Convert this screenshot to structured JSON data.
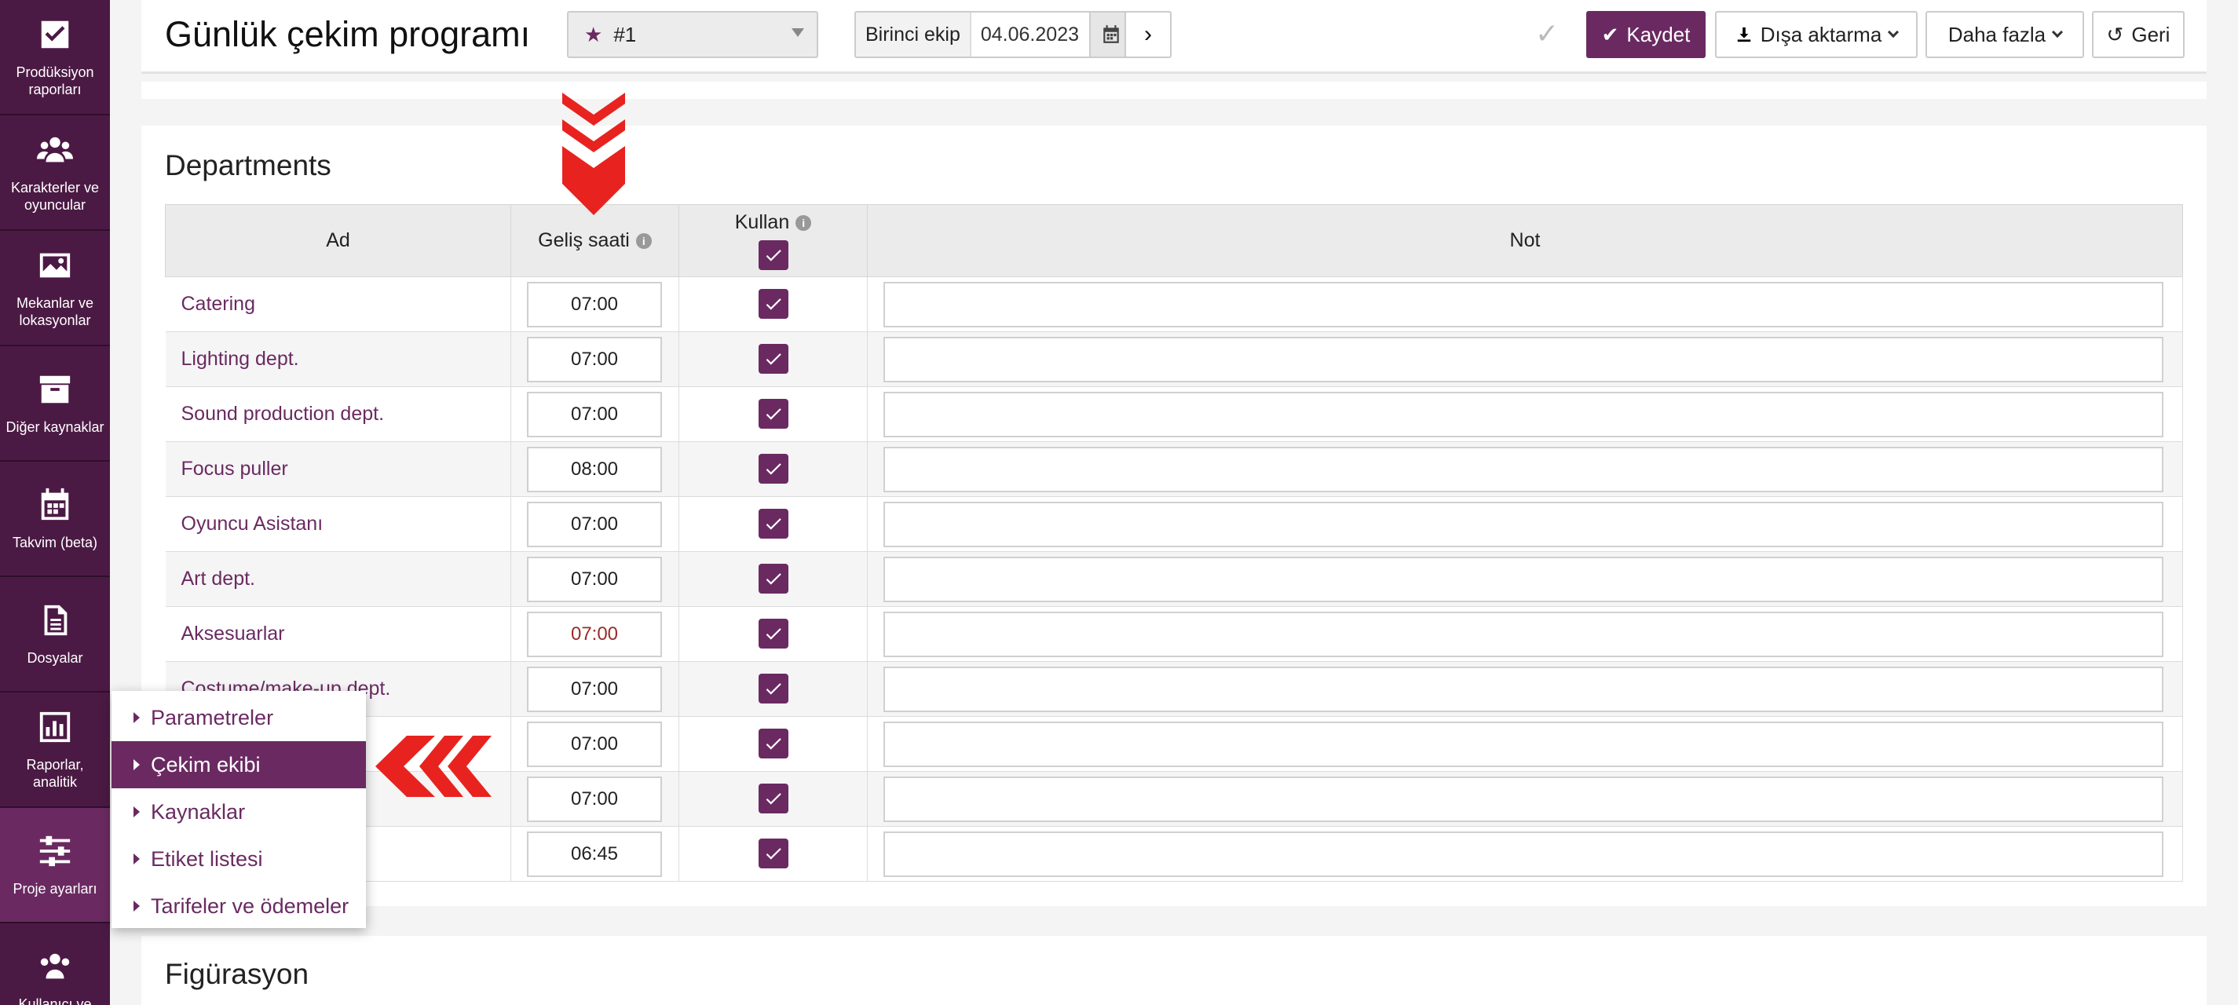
{
  "sidebar": {
    "items": [
      {
        "label": "Prodüksiyon raporları",
        "icon": "check-square-icon"
      },
      {
        "label": "Karakterler ve oyuncular",
        "icon": "users-icon"
      },
      {
        "label": "Mekanlar ve lokasyonlar",
        "icon": "image-icon"
      },
      {
        "label": "Diğer kaynaklar",
        "icon": "archive-icon"
      },
      {
        "label": "Takvim (beta)",
        "icon": "calendar-icon"
      },
      {
        "label": "Dosyalar",
        "icon": "file-icon"
      },
      {
        "label": "Raporlar, analitik",
        "icon": "bar-chart-icon"
      },
      {
        "label": "Proje ayarları",
        "icon": "sliders-icon"
      },
      {
        "label": "Kullanıcı ve",
        "icon": "users-icon"
      }
    ]
  },
  "header": {
    "title": "Günlük çekim programı",
    "version": "#1",
    "unit_label": "Birinci ekip",
    "date": "04.06.2023",
    "next_symbol": "›",
    "save_label": "Kaydet",
    "export_label": "Dışa aktarma",
    "more_label": "Daha fazla",
    "back_label": "Geri"
  },
  "departments": {
    "title": "Departments",
    "columns": {
      "name": "Ad",
      "arrival": "Geliş saati",
      "use": "Kullan",
      "note": "Not"
    },
    "rows": [
      {
        "name": "Catering",
        "time": "07:00",
        "checked": true
      },
      {
        "name": "Lighting dept.",
        "time": "07:00",
        "checked": true
      },
      {
        "name": "Sound production dept.",
        "time": "07:00",
        "checked": true
      },
      {
        "name": "Focus puller",
        "time": "08:00",
        "checked": true
      },
      {
        "name": "Oyuncu Asistanı",
        "time": "07:00",
        "checked": true
      },
      {
        "name": "Art dept.",
        "time": "07:00",
        "checked": true
      },
      {
        "name": "Aksesuarlar",
        "time": "07:00",
        "checked": true
      },
      {
        "name": "Costume/make-up dept.",
        "time": "07:00",
        "checked": true
      },
      {
        "name": "",
        "time": "07:00",
        "checked": true
      },
      {
        "name": "",
        "time": "07:00",
        "checked": true
      },
      {
        "name": "",
        "time": "06:45",
        "checked": true
      }
    ]
  },
  "figurasyon": {
    "title": "Figürasyon"
  },
  "flyout": {
    "items": [
      {
        "label": "Parametreler"
      },
      {
        "label": "Çekim ekibi"
      },
      {
        "label": "Kaynaklar"
      },
      {
        "label": "Etiket listesi"
      },
      {
        "label": "Tarifeler ve ödemeler"
      }
    ]
  }
}
